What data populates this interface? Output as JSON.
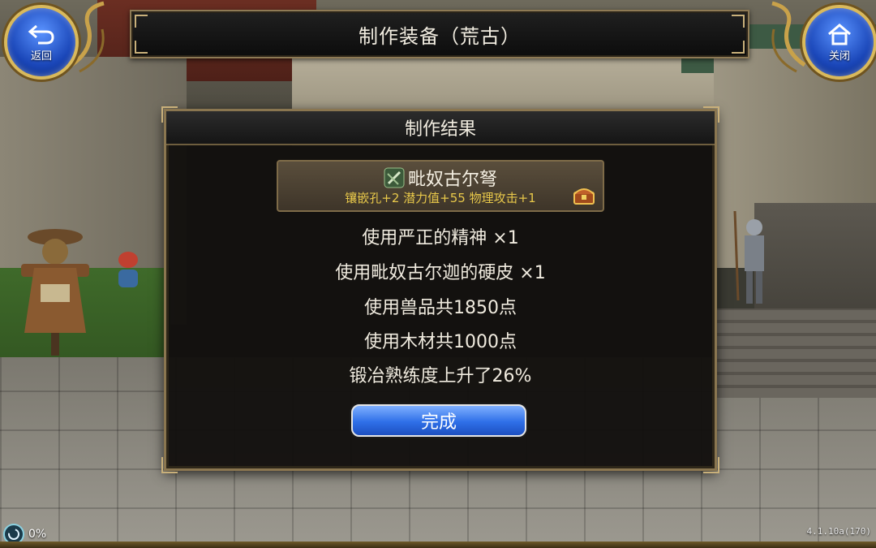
{
  "header": {
    "title": "制作装备（荒古）",
    "back_label": "返回",
    "close_label": "关闭"
  },
  "dialog": {
    "title": "制作结果",
    "item": {
      "name": "毗奴古尔弩",
      "stats": "镶嵌孔+2  潜力值+55  物理攻击+1",
      "icon": "crossbow-icon",
      "badge_icon": "treasure-chest-icon"
    },
    "lines": [
      "使用严正的精神 ×1",
      "使用毗奴古尔迦的硬皮 ×1",
      "使用兽品共1850点",
      "使用木材共1000点",
      "锻冶熟练度上升了26%"
    ],
    "done_label": "完成"
  },
  "status": {
    "loading_percent": "0%",
    "version": "4.1.10a(170)"
  },
  "colors": {
    "frame_gold": "#8a7650",
    "stat_yellow": "#e8c84a",
    "button_blue": "#2f6fe8"
  }
}
